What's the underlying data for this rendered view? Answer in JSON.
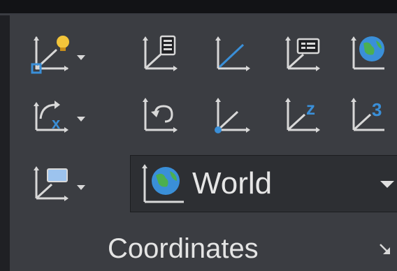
{
  "ucs_dropdown": {
    "value": "World"
  },
  "panel": {
    "title": "Coordinates"
  },
  "icons": {
    "row1": [
      "ucs-icon",
      "view-ucs-icon",
      "object-ucs-icon",
      "face-ucs-icon",
      "world-ucs-icon"
    ],
    "row2": [
      "ucs-x-rotate-icon",
      "previous-ucs-icon",
      "origin-ucs-icon",
      "z-axis-vector-icon",
      "three-point-ucs-icon"
    ],
    "row3": [
      "ucs-icon-properties-icon"
    ]
  },
  "colors": {
    "axis": "#d8d8d8",
    "accent_blue": "#3a8fd8",
    "bulb_yellow": "#f3c53a",
    "globe_green": "#4caf50"
  }
}
